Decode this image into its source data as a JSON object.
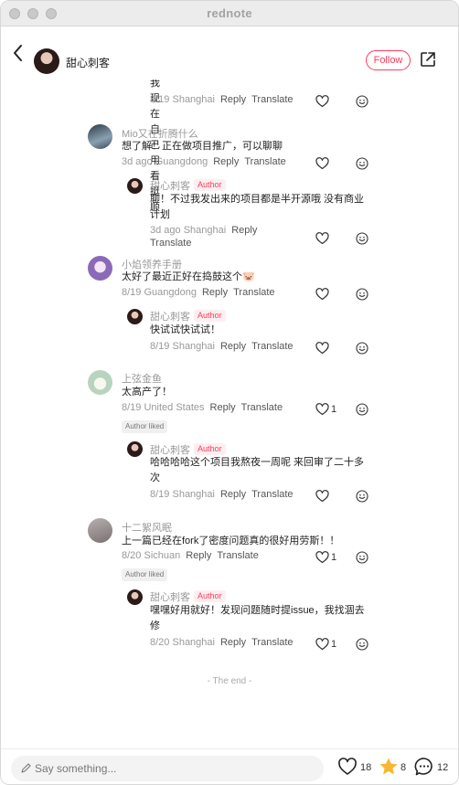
{
  "window": {
    "title": "rednote"
  },
  "header": {
    "author_name": "甜心刺客",
    "follow_label": "Follow"
  },
  "actions": {
    "reply": "Reply",
    "translate": "Translate"
  },
  "comments": [
    {
      "text": "我现在自己用看挺顺",
      "date": "8/19",
      "location": "Shanghai"
    },
    {
      "user": "Mio又在折腾什么",
      "text": "想了解！正在做项目推广，可以聊聊",
      "date": "3d ago",
      "location": "Guangdong"
    },
    {
      "user": "甜心刺客",
      "tag": "Author",
      "text_lines": [
        "聊！不过我发出来的项目都是半开源哦 没有商业",
        "计划"
      ],
      "date": "3d ago",
      "location": "Shanghai"
    },
    {
      "user": "小焰领养手册",
      "text": "太好了最近正好在捣鼓这个🐷",
      "date": "8/19",
      "location": "Guangdong"
    },
    {
      "user": "甜心刺客",
      "tag": "Author",
      "text": "快试试快试试！",
      "date": "8/19",
      "location": "Shanghai"
    },
    {
      "user": "上弦金鱼",
      "text": "太高产了！",
      "date": "8/19",
      "location": "United States",
      "likes": "1",
      "badge": "Author liked"
    },
    {
      "user": "甜心刺客",
      "tag": "Author",
      "text_lines": [
        "哈哈哈哈这个项目我熬夜一周呢 来回审了二十多",
        "次"
      ],
      "date": "8/19",
      "location": "Shanghai"
    },
    {
      "user": "十二絮风眠",
      "text": "上一篇已经在fork了密度问题真的很好用劳斯！！",
      "date": "8/20",
      "location": "Sichuan",
      "likes": "1",
      "badge": "Author liked"
    },
    {
      "user": "甜心刺客",
      "tag": "Author",
      "text_lines": [
        "嘿嘿好用就好！发现问题随时提issue，我找涸去",
        "修"
      ],
      "date": "8/20",
      "location": "Shanghai",
      "likes": "1"
    }
  ],
  "end_text": "- The end -",
  "bottom": {
    "placeholder": "Say something...",
    "likes": "18",
    "stars": "8",
    "comments": "12"
  },
  "icons": [
    "back-icon",
    "share-icon",
    "heart-icon",
    "face-icon",
    "pen-icon",
    "star-icon",
    "comment-bubble-icon"
  ],
  "colors": {
    "accent": "#ff3b5c",
    "star": "#f7b731"
  }
}
